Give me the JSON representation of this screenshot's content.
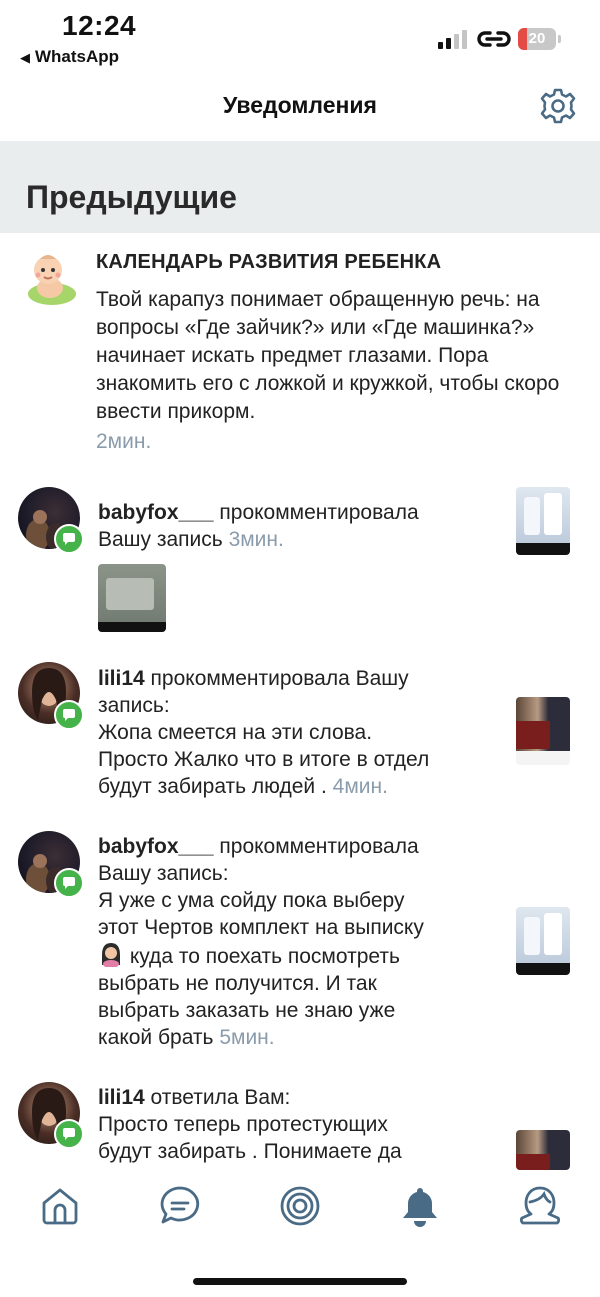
{
  "status_bar": {
    "time": "12:24",
    "back_app": "WhatsApp",
    "battery": "20",
    "battery_color": "#e34b44"
  },
  "nav": {
    "title": "Уведомления",
    "settings_icon": "gear-icon"
  },
  "section": {
    "title": "Предыдущие"
  },
  "calendar": {
    "title": "КАЛЕНДАРЬ РАЗВИТИЯ РЕБЕНКА",
    "body": "Твой карапуз понимает обращенную речь: на вопросы «Где зайчик?» или «Где машинка?» начинает искать предмет глазами. Пора знакомить его с ложкой и кружкой, чтобы скоро ввести прикорм.",
    "time": "2мин."
  },
  "notifications": [
    {
      "user": "babyfox___",
      "line1_rest": " прокомментировала",
      "line2": "Вашу запись ",
      "time": "3мин."
    },
    {
      "user": "lili14",
      "line1_rest": " прокомментировала Вашу",
      "line2": "запись:",
      "line3": "Жопа смеется на эти слова.",
      "line4": "Просто   Жалко что в итоге в отдел",
      "line5": "будут забирать людей  . ",
      "time": "4мин."
    },
    {
      "user": "babyfox___",
      "line1_rest": " прокомментировала",
      "line2": "Вашу запись:",
      "line3": "Я уже с ума сойду пока выберу",
      "line4": "этот Чертов комплект на выписку",
      "line5": " куда то поехать посмотреть",
      "line6": "выбрать не получится. И так",
      "line7": "выбрать заказать не знаю уже",
      "line8": "какой брать ",
      "time": "5мин."
    },
    {
      "user": "lili14",
      "line1_rest": " ответила Вам:",
      "line2": "Просто теперь протестующих",
      "line3": "будут забирать . Понимаете да"
    }
  ],
  "tabs": [
    "home-icon",
    "chat-icon",
    "target-icon",
    "bell-icon",
    "profile-icon"
  ],
  "colors": {
    "accent": "#4a6b86",
    "badge": "#46b24a",
    "muted_time": "#8a9bab",
    "section_bg": "#e9edee"
  }
}
